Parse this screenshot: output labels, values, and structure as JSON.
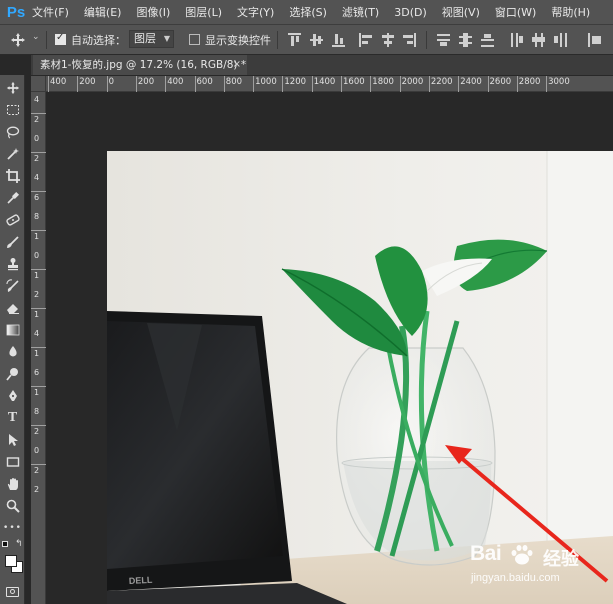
{
  "app": {
    "logo": "Ps"
  },
  "menu": [
    "文件(F)",
    "编辑(E)",
    "图像(I)",
    "图层(L)",
    "文字(Y)",
    "选择(S)",
    "滤镜(T)",
    "3D(D)",
    "视图(V)",
    "窗口(W)",
    "帮助(H)"
  ],
  "options": {
    "tool_icon": "move-icon",
    "auto_select_label": "自动选择：",
    "auto_select_checked": true,
    "auto_select_value": "图层",
    "show_transform_label": "显示变换控件",
    "show_transform_checked": false
  },
  "document": {
    "tab_title": "素材1-恢复的.jpg @ 17.2% (16, RGB/8) *",
    "close_glyph": "×"
  },
  "ruler_top": [
    "400",
    "200",
    "0",
    "200",
    "400",
    "600",
    "800",
    "1000",
    "1200",
    "1400",
    "1600",
    "1800",
    "2000",
    "2200",
    "2400",
    "2600",
    "2800",
    "3000"
  ],
  "ruler_left": [
    "4",
    "2",
    "0",
    "2",
    "4",
    "6",
    "8",
    "1",
    "0",
    "1",
    "2",
    "1",
    "4",
    "1",
    "6",
    "1",
    "8",
    "2",
    "0",
    "2",
    "2"
  ],
  "tools": [
    "move-tool-icon",
    "marquee-tool-icon",
    "lasso-tool-icon",
    "magic-wand-tool-icon",
    "crop-tool-icon",
    "eyedropper-tool-icon",
    "healing-brush-tool-icon",
    "brush-tool-icon",
    "clone-stamp-tool-icon",
    "history-brush-tool-icon",
    "eraser-tool-icon",
    "gradient-tool-icon",
    "blur-tool-icon",
    "dodge-tool-icon",
    "pen-tool-icon",
    "type-tool-icon",
    "path-selection-tool-icon",
    "rectangle-tool-icon",
    "hand-tool-icon",
    "zoom-tool-icon",
    "more-tools-icon"
  ],
  "type_tool_glyph": "T",
  "more_tools_glyph": "•••",
  "watermark": {
    "brand": "Bai",
    "cn": "经验",
    "url": "jingyan.baidu.com"
  },
  "laptop_brand": "DELL",
  "colors": {
    "accent": "#31a8ff",
    "arrow": "#e8261c",
    "panel": "#535353",
    "pasteboard": "#282828"
  }
}
